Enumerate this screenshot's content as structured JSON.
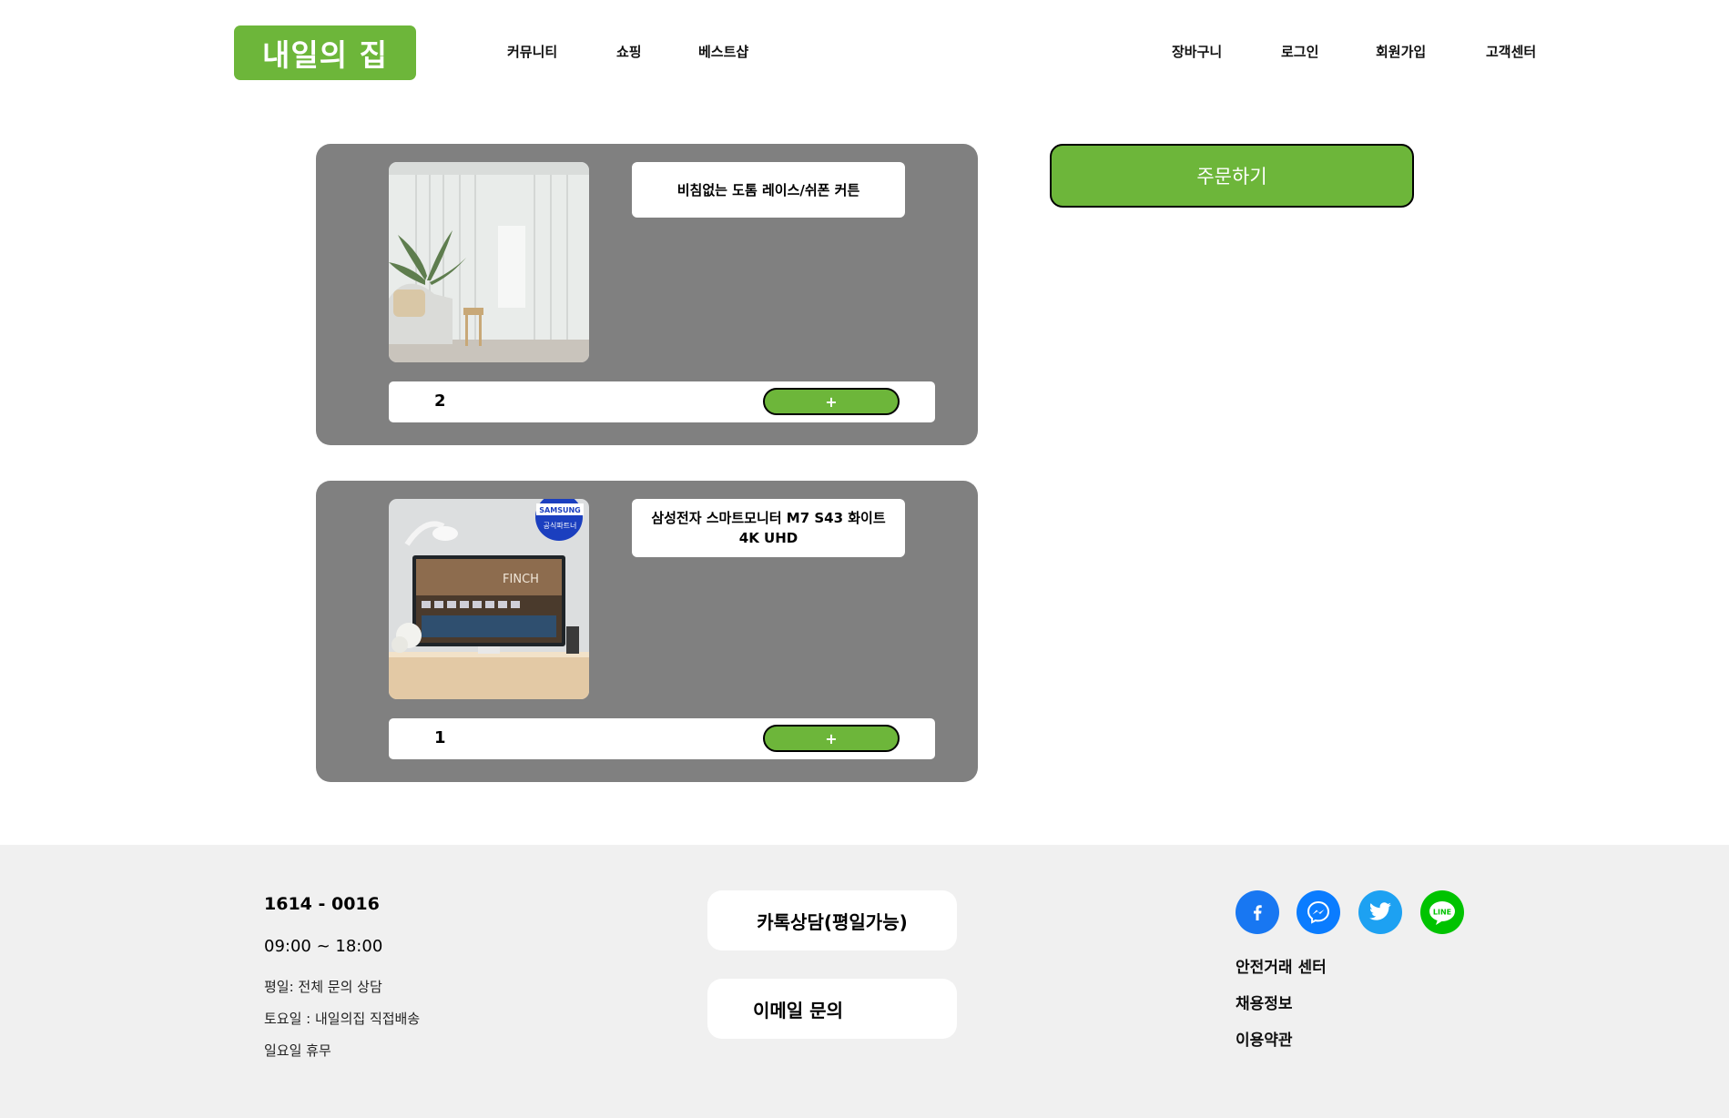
{
  "header": {
    "logo": "내일의 집",
    "nav_left": [
      "커뮤니티",
      "쇼핑",
      "베스트샵"
    ],
    "nav_right": [
      "장바구니",
      "로그인",
      "회원가입",
      "고객센터"
    ]
  },
  "cart": {
    "items": [
      {
        "title": "비침없는 도톰 레이스/쉬폰 커튼",
        "quantity": "2",
        "plus_label": "+"
      },
      {
        "title": "삼성전자 스마트모니터 M7 S43 화이트 4K UHD",
        "quantity": "1",
        "plus_label": "+",
        "badge": "SAMSUNG",
        "badge_sub": "공식파트너",
        "screen_text": "FINCH"
      }
    ],
    "order_button": "주문하기"
  },
  "footer": {
    "phone": "1614 - 0016",
    "hours": "09:00 ~ 18:00",
    "notes": [
      "평일: 전체 문의 상담",
      "토요일 : 내일의집 직접배송",
      "일요일 휴무"
    ],
    "buttons": [
      "카톡상담(평일가능)",
      "이메일 문의"
    ],
    "social": [
      {
        "icon": "facebook-icon",
        "color": "#1877f2"
      },
      {
        "icon": "messenger-icon",
        "color": "#0a7cff"
      },
      {
        "icon": "twitter-icon",
        "color": "#1da1f2"
      },
      {
        "icon": "line-icon",
        "color": "#00c300",
        "label": "LINE"
      }
    ],
    "links": [
      "안전거래 센터",
      "채용정보",
      "이용약관"
    ]
  },
  "colors": {
    "accent": "#6db63a",
    "card": "#808080",
    "footer_bg": "#f0f0f0"
  }
}
